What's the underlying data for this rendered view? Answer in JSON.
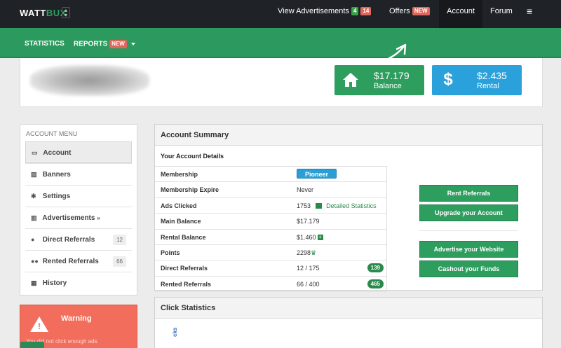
{
  "brand": {
    "part1": "WATT",
    "part2": "BUX",
    "toggle_icon": "updown-icon"
  },
  "topnav": {
    "view_ads_label": "View Advertisements",
    "ads_count_green": "4",
    "ads_count_red": "14",
    "offers_label": "Offers",
    "offers_badge": "NEW",
    "account_label": "Account",
    "forum_label": "Forum",
    "menu_icon": "hamburger-icon"
  },
  "subnav": {
    "statistics_label": "STATISTICS",
    "reports_label": "REPORTS",
    "reports_badge": "NEW"
  },
  "stats": {
    "balance_value": "$17.179",
    "balance_label": "Balance",
    "rental_value": "$2.435",
    "rental_label": "Rental"
  },
  "sidebar": {
    "title": "ACCOUNT MENU",
    "items": [
      {
        "label": "Account",
        "icon": "monitor-icon",
        "count": ""
      },
      {
        "label": "Banners",
        "icon": "image-icon",
        "count": ""
      },
      {
        "label": "Settings",
        "icon": "gear-icon",
        "count": ""
      },
      {
        "label": "Advertisements",
        "icon": "chart-icon",
        "count": ""
      },
      {
        "label": "Direct Referrals",
        "icon": "user-icon",
        "count": "12"
      },
      {
        "label": "Rented Referrals",
        "icon": "users-icon",
        "count": "66"
      },
      {
        "label": "History",
        "icon": "calendar-icon",
        "count": ""
      }
    ]
  },
  "warning": {
    "title": "Warning",
    "text": "You did not click enough ads."
  },
  "summary": {
    "title": "Account Summary",
    "details_title": "Your Account Details",
    "rows": [
      {
        "key": "Membership",
        "value": "Pioneer"
      },
      {
        "key": "Membership Expire",
        "value": "Never"
      },
      {
        "key": "Ads Clicked",
        "value": "1753",
        "link": "Detailed Statistics"
      },
      {
        "key": "Main Balance",
        "value": "$17.179"
      },
      {
        "key": "Rental Balance",
        "value": "$1.460"
      },
      {
        "key": "Points",
        "value": "2298"
      },
      {
        "key": "Direct Referrals",
        "value": "12 / 175",
        "badge": "139"
      },
      {
        "key": "Rented Referrals",
        "value": "66 / 400",
        "badge": "465"
      }
    ],
    "buttons": {
      "rent": "Rent Referrals",
      "upgrade": "Upgrade your Account",
      "advertise": "Advertise your Website",
      "cashout": "Cashout your Funds"
    }
  },
  "click_stats": {
    "title": "Click Statistics",
    "axis_fragment": "cks"
  }
}
